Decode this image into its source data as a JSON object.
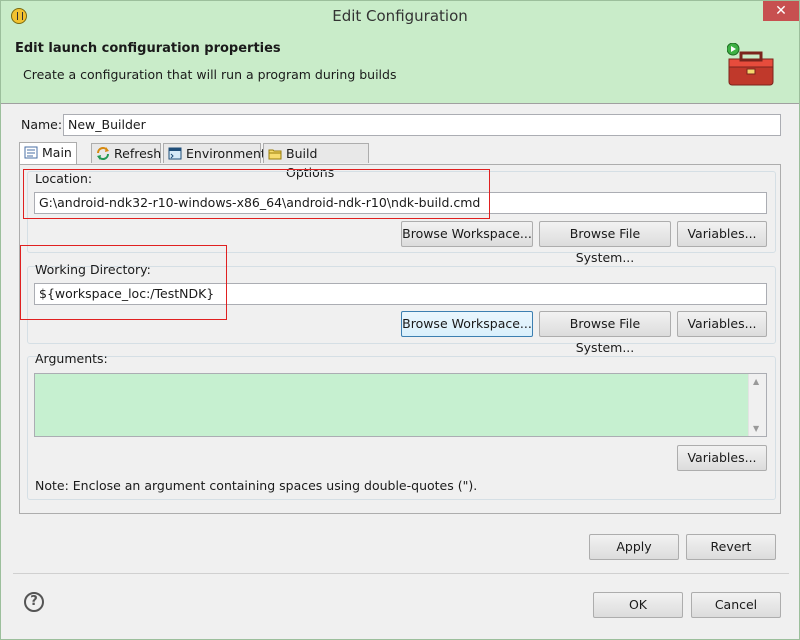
{
  "window": {
    "title": "Edit Configuration",
    "close_glyph": "✕"
  },
  "header": {
    "title": "Edit launch configuration properties",
    "description": "Create a configuration that will run a program during builds",
    "icon": "toolbox-run-icon"
  },
  "name_field": {
    "label": "Name:",
    "value": "New_Builder"
  },
  "tabs": [
    {
      "label": "Main",
      "icon": "main-tab-icon",
      "active": true
    },
    {
      "label": "Refresh",
      "icon": "refresh-icon",
      "active": false
    },
    {
      "label": "Environment",
      "icon": "environment-icon",
      "active": false
    },
    {
      "label": "Build Options",
      "icon": "folder-icon",
      "active": false
    }
  ],
  "location": {
    "label": "Location:",
    "value": "G:\\android-ndk32-r10-windows-x86_64\\android-ndk-r10\\ndk-build.cmd",
    "buttons": [
      "Browse Workspace...",
      "Browse File System...",
      "Variables..."
    ]
  },
  "working_directory": {
    "label": "Working Directory:",
    "value": "${workspace_loc:/TestNDK}",
    "buttons": [
      "Browse Workspace...",
      "Browse File System...",
      "Variables..."
    ]
  },
  "arguments": {
    "label": "Arguments:",
    "value": "",
    "variables_button": "Variables...",
    "note": "Note: Enclose an argument containing spaces using double-quotes (\")."
  },
  "actions": {
    "apply": "Apply",
    "revert": "Revert"
  },
  "footer": {
    "help_glyph": "?",
    "ok": "OK",
    "cancel": "Cancel"
  },
  "colors": {
    "header_bg": "#c9ecc9",
    "args_bg": "#c6f0d0",
    "highlight_box": "#e02020"
  }
}
